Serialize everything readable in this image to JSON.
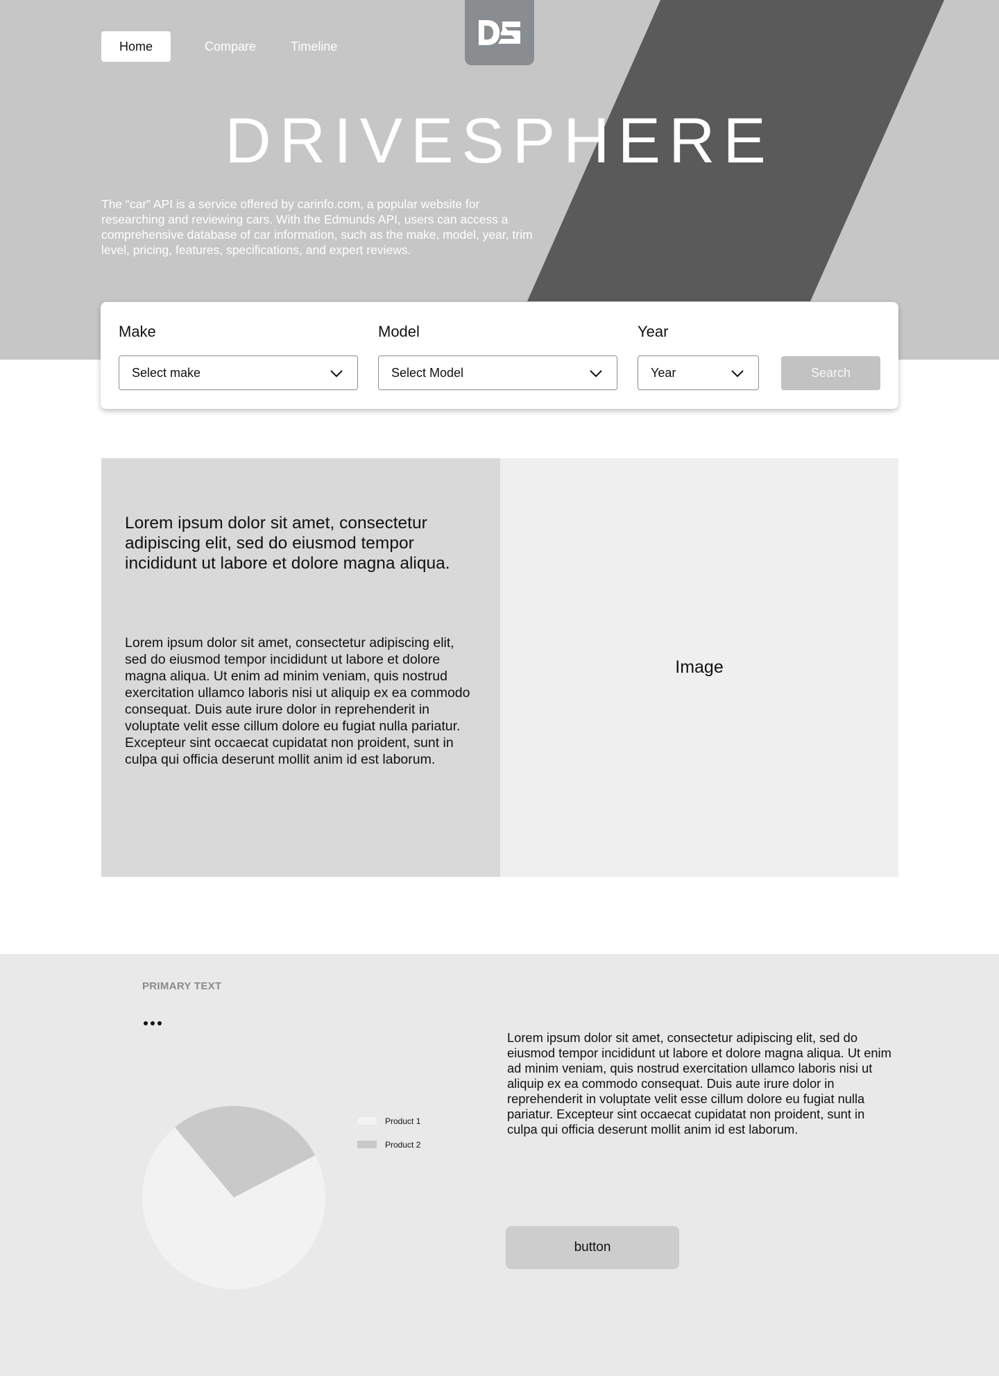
{
  "nav": {
    "items": [
      {
        "label": "Home",
        "active": true
      },
      {
        "label": "Compare",
        "active": false
      },
      {
        "label": "Timeline",
        "active": false
      }
    ]
  },
  "logo": {
    "text": "DS",
    "icon": "ds-logo-icon"
  },
  "hero": {
    "title": "DRIVESPHERE",
    "description": "The “car” API is a service offered by carinfo.com, a popular website for researching and reviewing cars. With the Edmunds API, users can access a comprehensive database of car information, such as the make, model, year, trim level, pricing, features, specifications, and expert reviews."
  },
  "search": {
    "make": {
      "label": "Make",
      "value": "Select make"
    },
    "model": {
      "label": "Model",
      "value": "Select Model"
    },
    "year": {
      "label": "Year",
      "value": "Year"
    },
    "button": "Search"
  },
  "content": {
    "heading": "Lorem ipsum dolor sit amet, consectetur adipiscing elit, sed do eiusmod tempor incididunt ut labore et dolore magna aliqua.",
    "body": "Lorem ipsum dolor sit amet, consectetur adipiscing elit, sed do eiusmod tempor incididunt ut labore et dolore magna aliqua. Ut enim ad minim veniam, quis nostrud exercitation ullamco laboris nisi ut aliquip ex ea commodo consequat. Duis aute irure dolor in reprehenderit in voluptate velit esse cillum dolore eu fugiat nulla pariatur. Excepteur sint occaecat cupidatat non proident, sunt in culpa qui officia deserunt mollit anim id est laborum.",
    "image_label": "Image"
  },
  "bottom": {
    "primary_text": "PRIMARY TEXT",
    "menu_icon": "more-dots-icon",
    "paragraph": "Lorem ipsum dolor sit amet, consectetur adipiscing elit, sed do eiusmod tempor incididunt ut labore et dolore magna aliqua. Ut enim ad minim veniam, quis nostrud exercitation ullamco laboris nisi ut aliquip ex ea commodo consequat. Duis aute irure dolor in reprehenderit in voluptate velit esse cillum dolore eu fugiat nulla pariatur. Excepteur sint occaecat cupidatat non proident, sunt in culpa qui officia deserunt mollit anim id est laborum.",
    "button": "button"
  },
  "colors": {
    "hero_bg": "#c6c6c6",
    "hero_stripe": "#5a5a5a",
    "logo_tile": "#8a8d8f",
    "search_button": "#c2c2c2",
    "pie_product1": "#f2f2f2",
    "pie_product2": "#c9c9c9"
  },
  "chart_data": {
    "type": "pie",
    "categories": [
      "Product 1",
      "Product 2"
    ],
    "values": [
      71.5,
      28.5
    ],
    "colors": [
      "#f2f2f2",
      "#c9c9c9"
    ],
    "legend": "right"
  }
}
